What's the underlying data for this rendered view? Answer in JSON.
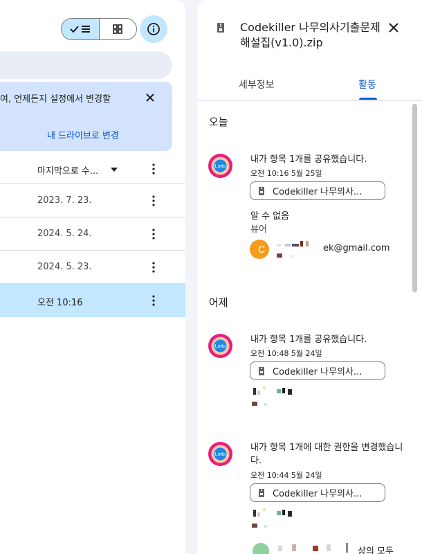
{
  "left": {
    "banner": {
      "text": "여, 언제든지 설정에서 변경할",
      "link": "내 드라이브로 변경"
    },
    "column_header": "마지막으로 수...",
    "rows": [
      {
        "date": "2023. 7. 23."
      },
      {
        "date": "2024. 5. 24."
      },
      {
        "date": "2024. 5. 23."
      },
      {
        "date": "오전 10:16"
      }
    ]
  },
  "panel": {
    "title": "Codekiller 나무의사기출문제 해설집(v1.0).zip",
    "tabs": {
      "details": "세부정보",
      "activity": "활동"
    },
    "groups": [
      {
        "day": "오늘",
        "activities": [
          {
            "text": "내가 항목 1개를 공유했습니다.",
            "time": "오전 10:16 5월 25일",
            "chip": "Codekiller 나무의사...",
            "unknown": "알 수 없음",
            "role": "뷰어",
            "email": "ek@gmail.com"
          }
        ]
      },
      {
        "day": "어제",
        "activities": [
          {
            "text": "내가 항목 1개를 공유했습니다.",
            "time": "오전 10:48 5월 24일",
            "chip": "Codekiller 나무의사..."
          },
          {
            "text": "내가 항목 1개에 대한 권한을 변경했습니다.",
            "time": "오전 10:44 5월 24일",
            "chip": "Codekiller 나무의사...",
            "tail": "상의 모두"
          }
        ]
      }
    ]
  },
  "colors": {
    "accent": "#0b57d0",
    "selected": "#c2e7ff",
    "banner": "#d3e3fd"
  }
}
